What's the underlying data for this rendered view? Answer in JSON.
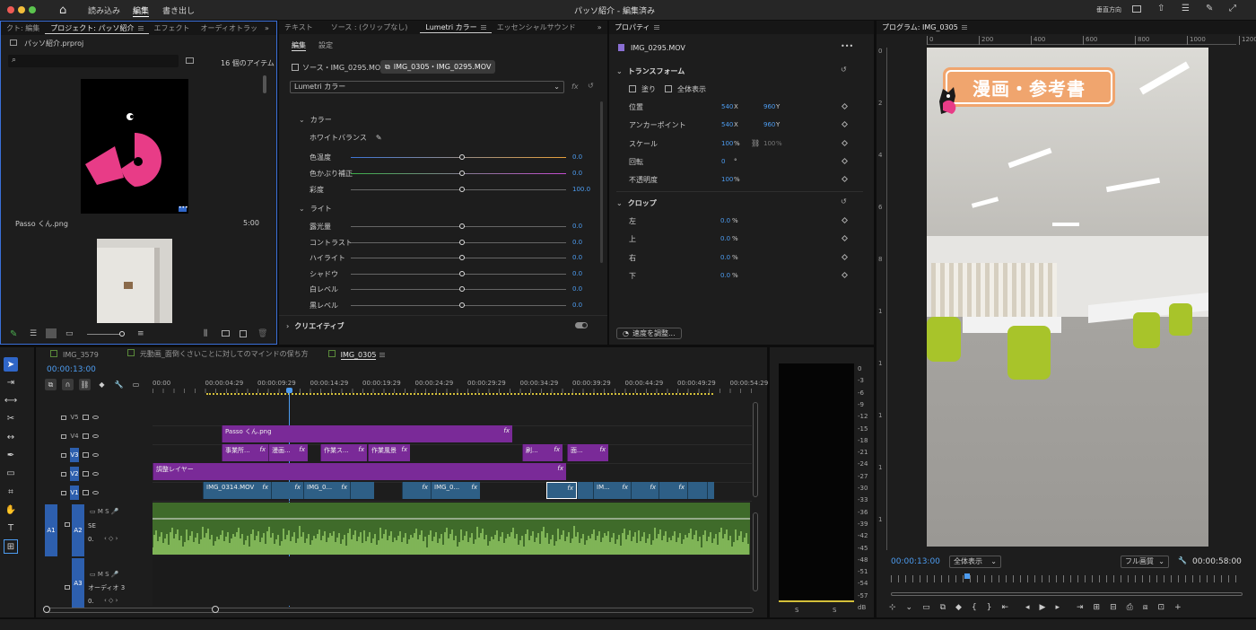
{
  "titlebar": {
    "title": "パッソ紹介 - 編集済み",
    "menu": [
      "読み込み",
      "編集",
      "書き出し"
    ],
    "active": "編集",
    "right_label": "垂直方向"
  },
  "project": {
    "tabs": [
      "クト: 編集",
      "プロジェクト: パッソ紹介",
      "エフェクト",
      "オーディオトラッ"
    ],
    "file": "パッソ紹介.prproj",
    "search_placeholder": "",
    "item_count": "16 個のアイテム",
    "items": [
      {
        "name": "Passo くん.png",
        "duration": "5:00"
      }
    ]
  },
  "lumetri": {
    "tabs": [
      "テキスト",
      "ソース : (クリップなし)",
      "Lumetri カラー",
      "エッセンシャルサウンド"
    ],
    "subtabs": [
      "編集",
      "設定"
    ],
    "clips": [
      "ソース・IMG_0295.MOV",
      "IMG_0305・IMG_0295.MOV"
    ],
    "effect": "Lumetri カラー",
    "section_color": "カラー",
    "white_balance": "ホワイトバランス",
    "sliders_color": [
      {
        "label": "色温度",
        "value": "0.0"
      },
      {
        "label": "色かぶり補正",
        "value": "0.0"
      },
      {
        "label": "彩度",
        "value": "100.0"
      }
    ],
    "section_light": "ライト",
    "sliders_light": [
      {
        "label": "露光量",
        "value": "0.0"
      },
      {
        "label": "コントラスト",
        "value": "0.0"
      },
      {
        "label": "ハイライト",
        "value": "0.0"
      },
      {
        "label": "シャドウ",
        "value": "0.0"
      },
      {
        "label": "白レベル",
        "value": "0.0"
      },
      {
        "label": "黒レベル",
        "value": "0.0"
      }
    ],
    "section_creative": "クリエイティブ"
  },
  "properties": {
    "tab": "プロパティ",
    "clip": "IMG_0295.MOV",
    "transform": "トランスフォーム",
    "fill": "塗り",
    "show_all": "全体表示",
    "rows": [
      {
        "label": "位置",
        "x": "540",
        "xu": "X",
        "y": "960",
        "yu": "Y"
      },
      {
        "label": "アンカーポイント",
        "x": "540",
        "xu": "X",
        "y": "960",
        "yu": "Y"
      },
      {
        "label": "スケール",
        "x": "100",
        "xu": "%",
        "y": "100",
        "yu": "%"
      },
      {
        "label": "回転",
        "x": "0",
        "xu": "°"
      },
      {
        "label": "不透明度",
        "x": "100",
        "xu": "%"
      }
    ],
    "crop": "クロップ",
    "crop_rows": [
      {
        "label": "左",
        "v": "0.0",
        "u": "%"
      },
      {
        "label": "上",
        "v": "0.0",
        "u": "%"
      },
      {
        "label": "右",
        "v": "0.0",
        "u": "%"
      },
      {
        "label": "下",
        "v": "0.0",
        "u": "%"
      }
    ],
    "speed_btn": "速度を調整..."
  },
  "program": {
    "tab": "プログラム: IMG_0305",
    "ruler": [
      "0",
      "200",
      "400",
      "600",
      "800",
      "1000",
      "1200"
    ],
    "vruler": [
      "0",
      "2",
      "4",
      "6",
      "8",
      "1",
      "1",
      "1",
      "1",
      "1"
    ],
    "overlay_title": "漫画・参考書",
    "timecode": "00:00:13:00",
    "fit": "全体表示",
    "quality": "フル画質",
    "duration": "00:00:58:00"
  },
  "timeline": {
    "tabs": [
      "IMG_3579",
      "元動画_面倒くさいことに対してのマインドの保ち方",
      "IMG_0305"
    ],
    "timecode": "00:00:13:00",
    "ruler": [
      "00:00",
      "00:00:04:29",
      "00:00:09:29",
      "00:00:14:29",
      "00:00:19:29",
      "00:00:24:29",
      "00:00:29:29",
      "00:00:34:29",
      "00:00:39:29",
      "00:00:44:29",
      "00:00:49:29",
      "00:00:54:29"
    ],
    "tracks": [
      "V5",
      "V4",
      "V3",
      "V2",
      "V1",
      "A1",
      "A2",
      "A3"
    ],
    "a2_label": "SE",
    "a3_label": "オーディオ 3",
    "a_value": "0.",
    "clips": {
      "v4": [
        {
          "name": "Passo くん.png"
        }
      ],
      "v3": [
        {
          "name": "事業所..."
        },
        {
          "name": "漫画..."
        },
        {
          "name": "作業ス..."
        },
        {
          "name": "作業風景"
        },
        {
          "name": "刷..."
        },
        {
          "name": "面..."
        }
      ],
      "v2": [
        {
          "name": "調整レイヤー"
        }
      ],
      "v1": [
        {
          "name": "IMG_0314.MOV"
        },
        {
          "name": ""
        },
        {
          "name": "IMG_0..."
        },
        {
          "name": ""
        },
        {
          "name": ""
        },
        {
          "name": "IMG_0..."
        },
        {
          "name": ""
        },
        {
          "name": ""
        },
        {
          "name": "IM..."
        },
        {
          "name": ""
        },
        {
          "name": ""
        },
        {
          "name": ""
        },
        {
          "name": ""
        }
      ]
    }
  },
  "meter": {
    "scale": [
      "0",
      "-3",
      "-6",
      "-9",
      "-12",
      "-15",
      "-18",
      "-21",
      "-24",
      "-27",
      "-30",
      "-33",
      "-36",
      "-39",
      "-42",
      "-45",
      "-48",
      "-51",
      "-54",
      "-57",
      "dB"
    ],
    "channels": [
      "S",
      "S"
    ]
  }
}
